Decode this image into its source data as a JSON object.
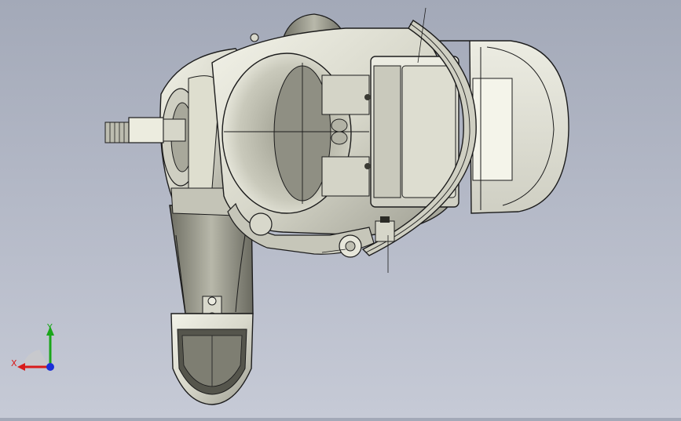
{
  "viewport": {
    "background_top": "#a3a9b8",
    "background_bottom": "#c6cad6"
  },
  "model": {
    "type": "robot-wrist-assembly",
    "render_mode": "shaded-with-edges",
    "body_color": "#e4e4d8",
    "shadow_color": "#8e8e82",
    "edge_color": "#1c1c1c"
  },
  "triad": {
    "x_label": "X",
    "y_label": "Y",
    "x_color": "#d81b1b",
    "y_color": "#1aa61a",
    "z_color": "#1b2fd8"
  }
}
